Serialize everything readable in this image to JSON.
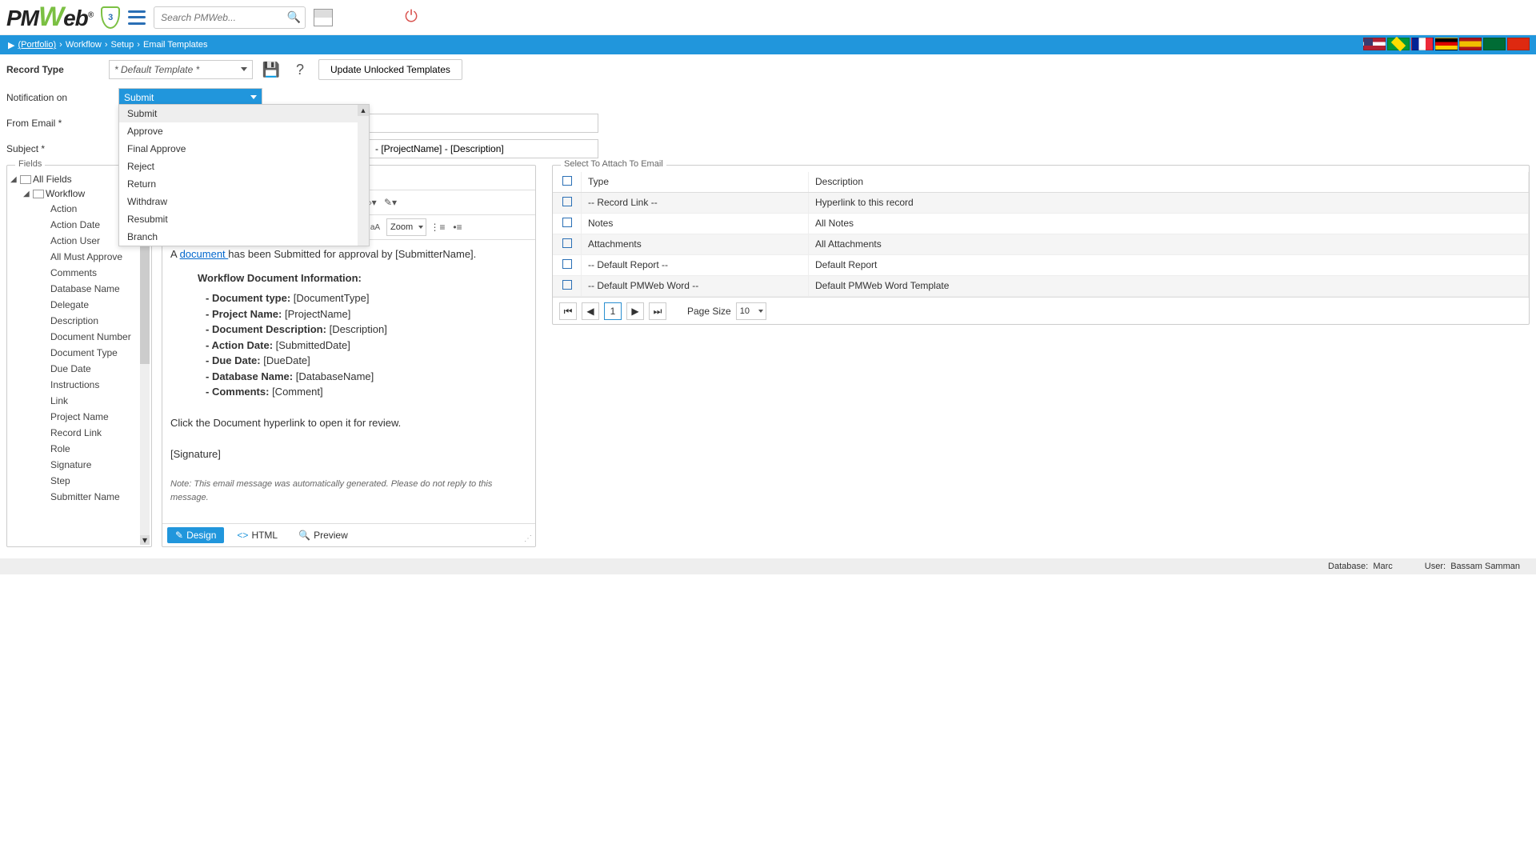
{
  "header": {
    "logo_text": "PMWeb",
    "shield_count": "3",
    "search_placeholder": "Search PMWeb..."
  },
  "breadcrumb": {
    "portfolio": "(Portfolio)",
    "workflow": "Workflow",
    "setup": "Setup",
    "page": "Email Templates"
  },
  "toolbar": {
    "record_type_label": "Record Type",
    "record_type_value": "* Default Template *",
    "update_btn": "Update Unlocked Templates"
  },
  "form": {
    "notification_label": "Notification on",
    "notification_value": "Submit",
    "from_label": "From Email *",
    "subject_label": "Subject *",
    "subject_value": "- [ProjectName] - [Description]"
  },
  "dropdown_options": [
    "Submit",
    "Approve",
    "Final Approve",
    "Reject",
    "Return",
    "Withdraw",
    "Resubmit",
    "Branch"
  ],
  "fields_panel": {
    "title": "Fields",
    "root": "All Fields",
    "workflow": "Workflow",
    "leaves": [
      "Action",
      "Action Date",
      "Action User",
      "All Must Approve",
      "Comments",
      "Database Name",
      "Delegate",
      "Description",
      "Document Number",
      "Document Type",
      "Due Date",
      "Instructions",
      "Link",
      "Project Name",
      "Record Link",
      "Role",
      "Signature",
      "Step",
      "Submitter Name"
    ]
  },
  "editor": {
    "font_size": "13px",
    "zoom": "Zoom",
    "line1_pre": "A ",
    "line1_link": "document ",
    "line1_post": "has been Submitted for approval by [SubmitterName].",
    "info_header": "Workflow Document Information:",
    "info": [
      {
        "k": "Document type:",
        "v": "[DocumentType]"
      },
      {
        "k": "Project Name:",
        "v": "[ProjectName]"
      },
      {
        "k": "Document Description:",
        "v": "[Description]"
      },
      {
        "k": "Action Date:",
        "v": "[SubmittedDate]"
      },
      {
        "k": "Due Date:",
        "v": "[DueDate]"
      },
      {
        "k": "Database Name:",
        "v": "[DatabaseName]"
      },
      {
        "k": "Comments:",
        "v": "[Comment]"
      }
    ],
    "line2": "Click the Document hyperlink to open it for review.",
    "signature": "[Signature]",
    "note": "Note: This email message was automatically generated. Please do not reply to this message.",
    "tab_design": "Design",
    "tab_html": "HTML",
    "tab_preview": "Preview"
  },
  "attach": {
    "title": "Select To Attach To Email",
    "col_type": "Type",
    "col_desc": "Description",
    "rows": [
      {
        "t": "-- Record Link --",
        "d": "Hyperlink to this record"
      },
      {
        "t": "Notes",
        "d": "All Notes"
      },
      {
        "t": "Attachments",
        "d": "All Attachments"
      },
      {
        "t": "-- Default Report --",
        "d": "Default Report"
      },
      {
        "t": "-- Default PMWeb Word --",
        "d": "Default PMWeb Word Template"
      }
    ],
    "page_size_label": "Page Size",
    "page_size": "10",
    "page_num": "1"
  },
  "footer": {
    "db_label": "Database:",
    "db_value": "Marc",
    "user_label": "User:",
    "user_value": "Bassam Samman"
  }
}
